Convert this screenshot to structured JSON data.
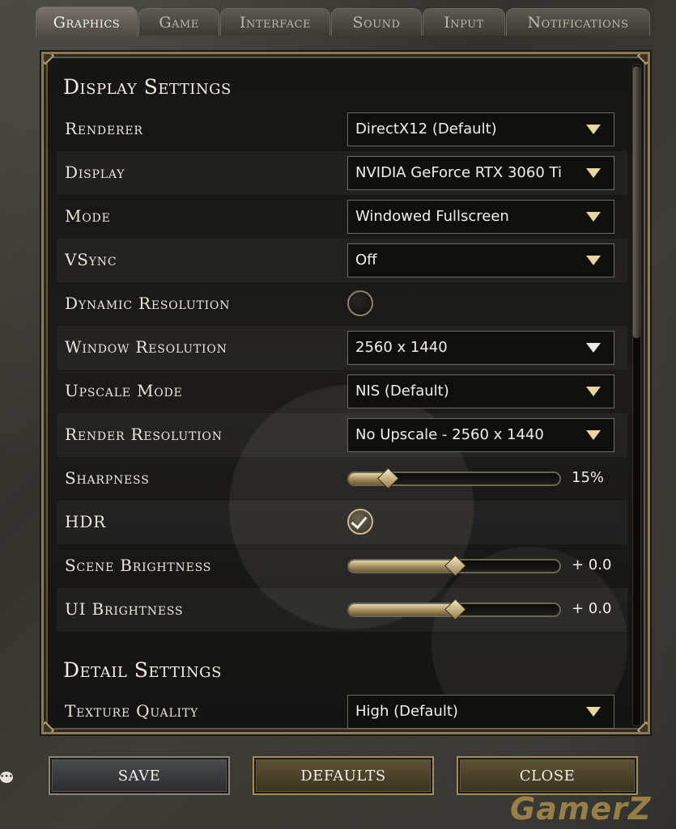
{
  "tabs": [
    {
      "label": "Graphics",
      "active": true
    },
    {
      "label": "Game"
    },
    {
      "label": "Interface"
    },
    {
      "label": "Sound"
    },
    {
      "label": "Input"
    },
    {
      "label": "Notifications"
    }
  ],
  "display_section": {
    "title": "Display Settings",
    "rows": [
      {
        "label": "Renderer",
        "type": "dropdown",
        "value": "DirectX12 (Default)"
      },
      {
        "label": "Display",
        "type": "dropdown",
        "value": "NVIDIA GeForce RTX 3060 Ti"
      },
      {
        "label": "Mode",
        "type": "dropdown",
        "value": "Windowed Fullscreen"
      },
      {
        "label": "VSync",
        "type": "dropdown",
        "value": "Off"
      },
      {
        "label": "Dynamic Resolution",
        "type": "toggle",
        "checked": false
      },
      {
        "label": "Window Resolution",
        "type": "dropdown",
        "value": "2560 x 1440"
      },
      {
        "label": "Upscale Mode",
        "type": "dropdown",
        "value": "NIS (Default)"
      },
      {
        "label": "Render Resolution",
        "type": "dropdown",
        "value": "No Upscale - 2560 x 1440"
      },
      {
        "label": "Sharpness",
        "type": "slider",
        "value_text": "15%",
        "fraction": 0.18
      },
      {
        "label": "HDR",
        "type": "toggle",
        "checked": true
      },
      {
        "label": "Scene Brightness",
        "type": "slider",
        "value_text": "+ 0.0",
        "fraction": 0.5
      },
      {
        "label": "UI Brightness",
        "type": "slider",
        "value_text": "+ 0.0",
        "fraction": 0.5
      }
    ]
  },
  "detail_section": {
    "title": "Detail Settings",
    "rows": [
      {
        "label": "Texture Quality",
        "type": "dropdown",
        "value": "High (Default)"
      }
    ]
  },
  "buttons": {
    "save": "SAVE",
    "defaults": "DEFAULTS",
    "close": "CLOSE"
  },
  "watermark": "GamerZ",
  "colors": {
    "accent_gold": "#e6d7a4",
    "panel_bg": "#161614",
    "frame_stone": "#3f3c36"
  }
}
